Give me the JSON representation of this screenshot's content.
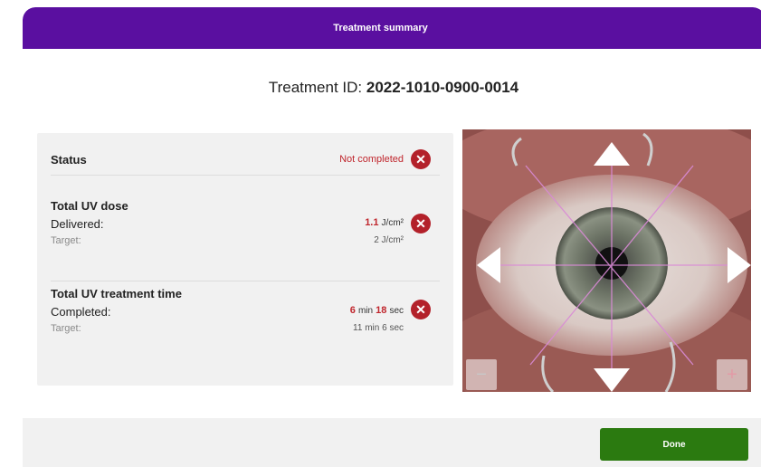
{
  "dialog": {
    "title": "Treatment summary"
  },
  "treatment": {
    "id_label": "Treatment ID:",
    "id_value": "2022-1010-0900-0014"
  },
  "status": {
    "label": "Status",
    "value": "Not completed",
    "icon": "close-circle-icon",
    "color": "#c0262d"
  },
  "uv_dose": {
    "title": "Total UV dose",
    "delivered_label": "Delivered:",
    "delivered_value": "1.1",
    "delivered_unit": "J/cm²",
    "target_label": "Target:",
    "target_value": "2",
    "target_unit": "J/cm²"
  },
  "uv_time": {
    "title": "Total UV treatment time",
    "completed_label": "Completed:",
    "completed_min": "6",
    "completed_sec": "18",
    "target_label": "Target:",
    "target_min": "11",
    "target_sec": "6",
    "min_unit": "min",
    "sec_unit": "sec"
  },
  "eye_view": {
    "zoom_out": "−",
    "zoom_in": "+",
    "arrows": [
      "arrow-up-icon",
      "arrow-down-icon",
      "arrow-left-icon",
      "arrow-right-icon"
    ]
  },
  "footer": {
    "done_label": "Done"
  },
  "colors": {
    "header": "#5a0fa0",
    "done": "#2b7a10",
    "error": "#b3212a"
  }
}
